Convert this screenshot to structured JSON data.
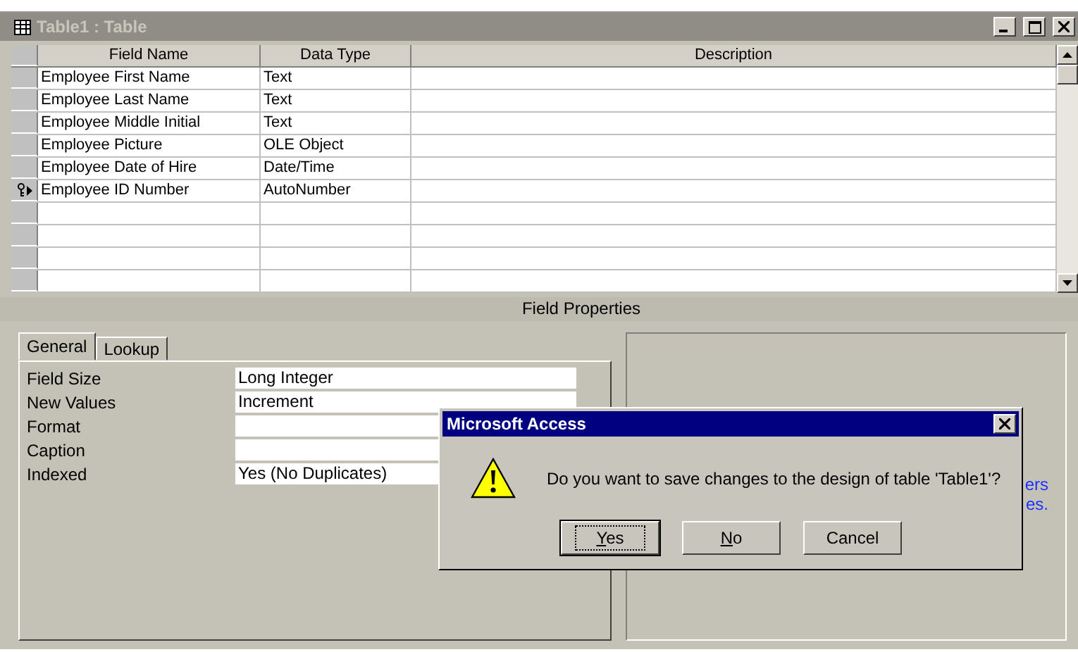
{
  "window": {
    "title": "Table1 : Table"
  },
  "grid": {
    "columns": [
      "Field Name",
      "Data Type",
      "Description"
    ],
    "rows": [
      {
        "field_name": "Employee First Name",
        "data_type": "Text",
        "primary_key": false,
        "current": false
      },
      {
        "field_name": "Employee Last Name",
        "data_type": "Text",
        "primary_key": false,
        "current": false
      },
      {
        "field_name": "Employee Middle Initial",
        "data_type": "Text",
        "primary_key": false,
        "current": false
      },
      {
        "field_name": "Employee Picture",
        "data_type": "OLE Object",
        "primary_key": false,
        "current": false
      },
      {
        "field_name": "Employee Date of Hire",
        "data_type": "Date/Time",
        "primary_key": false,
        "current": false
      },
      {
        "field_name": "Employee ID Number",
        "data_type": "AutoNumber",
        "primary_key": true,
        "current": true
      }
    ]
  },
  "field_properties": {
    "title": "Field Properties",
    "tabs": [
      {
        "label": "General",
        "selected": true
      },
      {
        "label": "Lookup",
        "selected": false
      }
    ],
    "properties": [
      {
        "label": "Field Size",
        "value": "Long Integer"
      },
      {
        "label": "New Values",
        "value": "Increment"
      },
      {
        "label": "Format"
      },
      {
        "label": "Caption"
      },
      {
        "label": "Indexed",
        "value": "Yes (No Duplicates)"
      }
    ],
    "help_fragments": [
      "ers",
      "es."
    ]
  },
  "dialog": {
    "title": "Microsoft Access",
    "message": "Do you want to save changes to the design of table 'Table1'?",
    "buttons": [
      {
        "label": "Yes",
        "default": true,
        "mnemonic": true
      },
      {
        "label": "No",
        "default": false,
        "mnemonic": true
      },
      {
        "label": "Cancel",
        "default": false,
        "mnemonic": false
      }
    ]
  }
}
